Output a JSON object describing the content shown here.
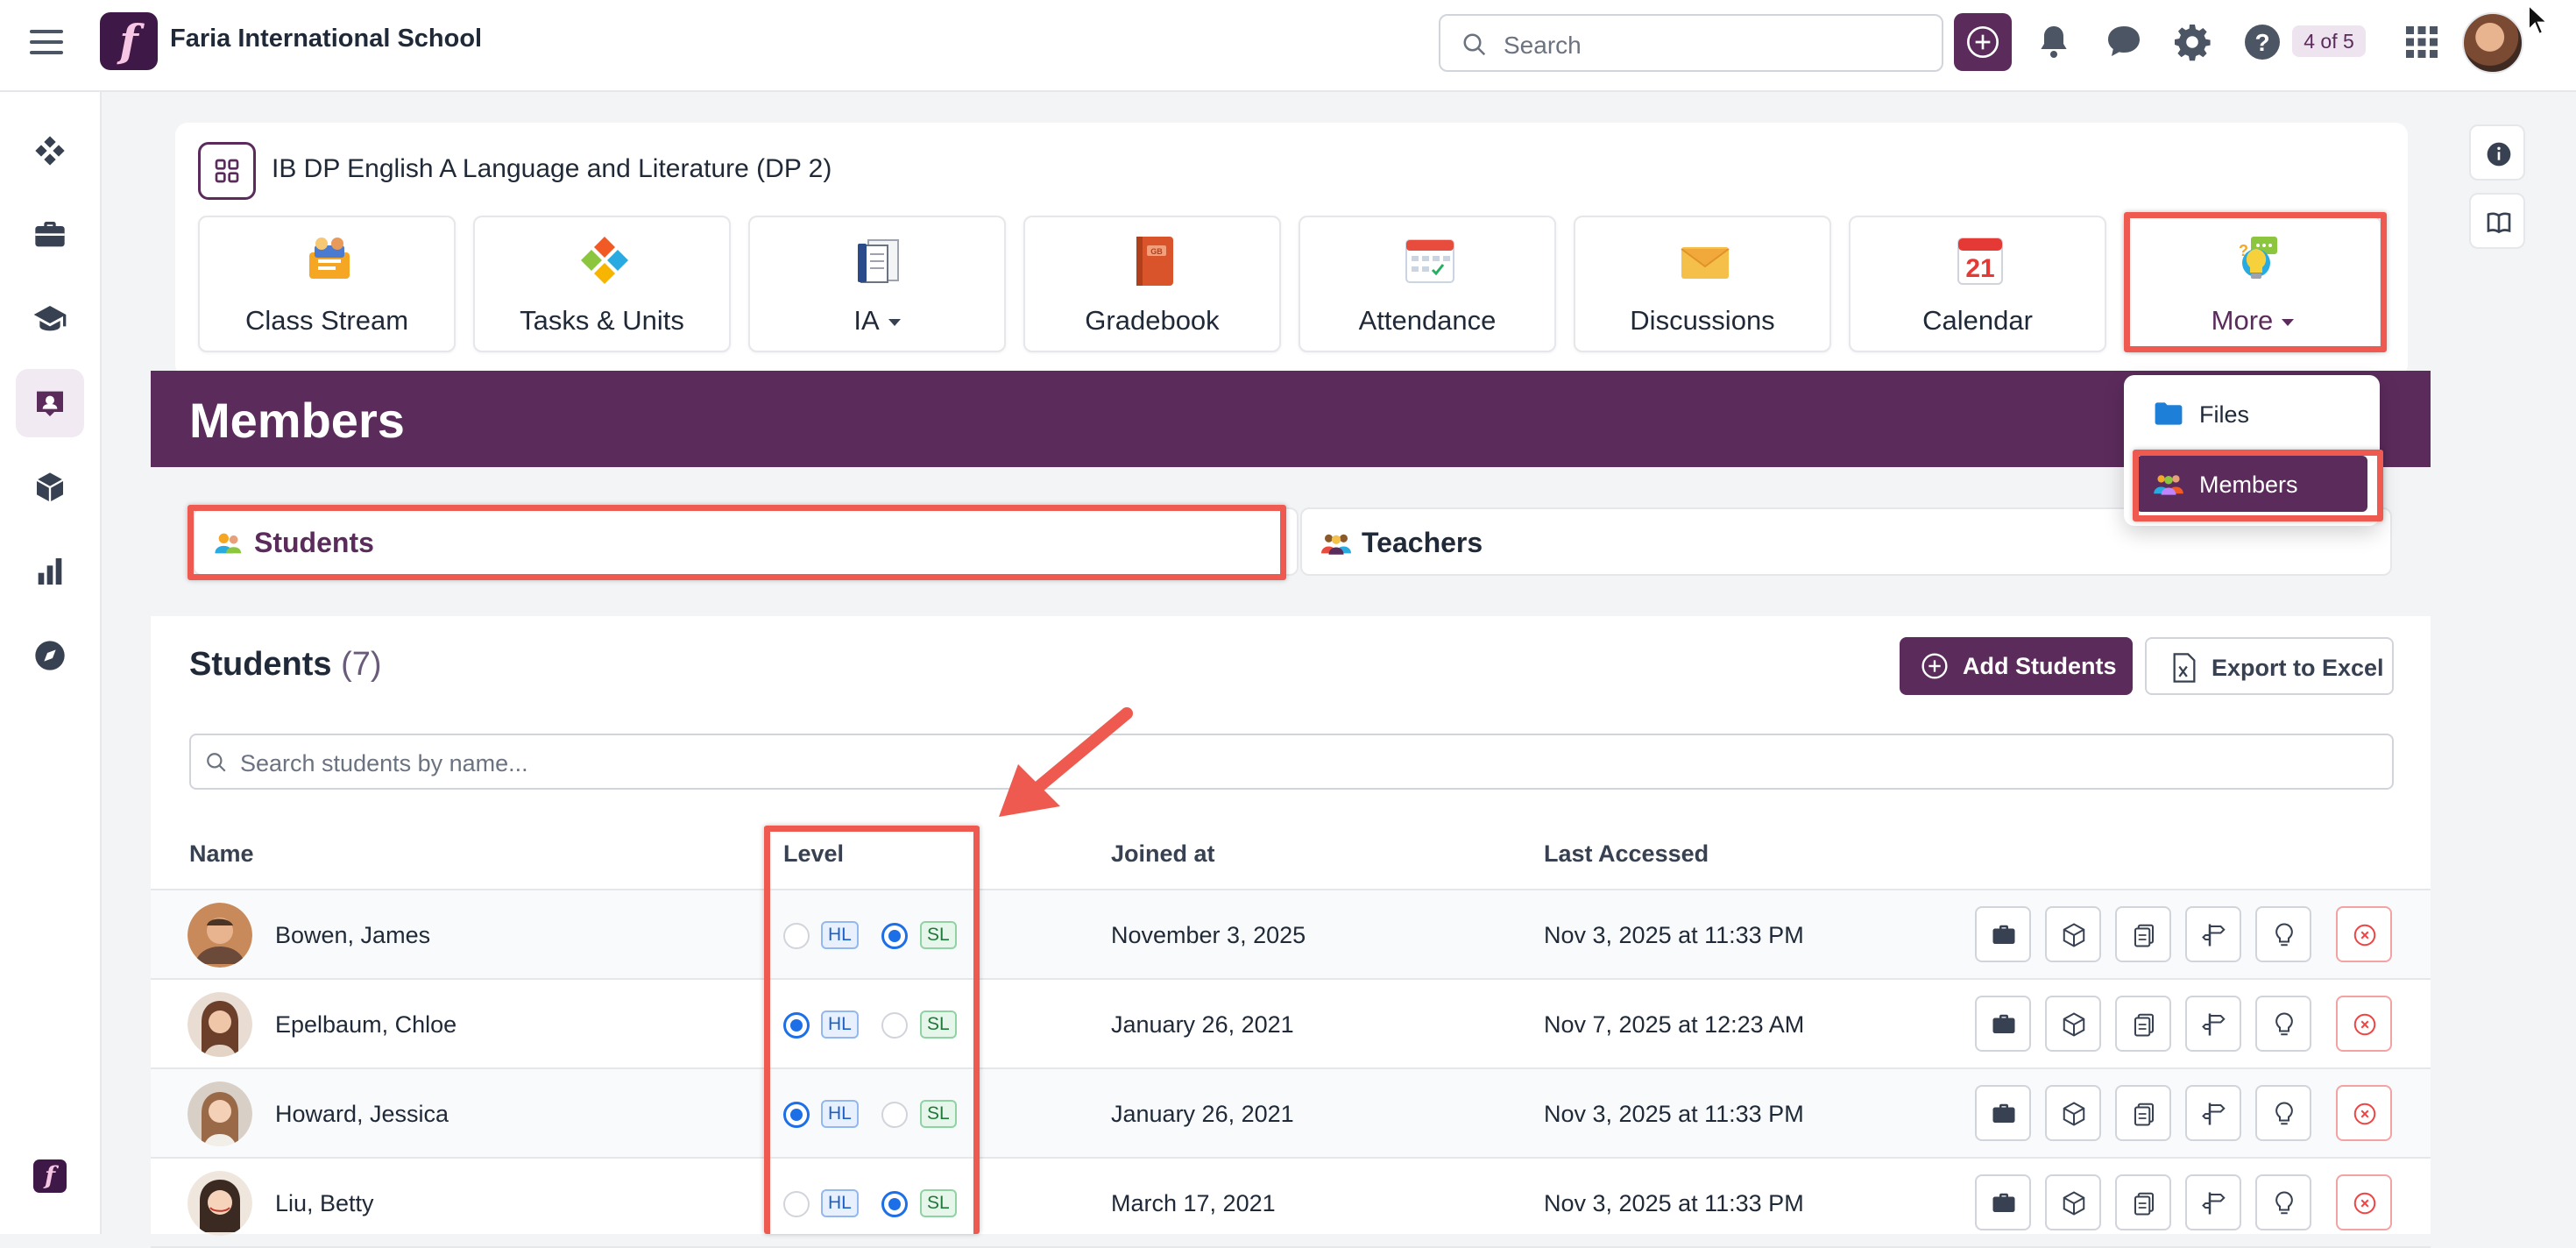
{
  "topbar": {
    "school_name": "Faria International School",
    "logo_letter": "f",
    "search_placeholder": "Search",
    "help_badge": "4 of 5",
    "icons": [
      "menu-icon",
      "plus-icon",
      "bell-icon",
      "chat-icon",
      "gear-icon",
      "help-icon",
      "apps-grid-icon",
      "avatar"
    ]
  },
  "sidebar": {
    "items": [
      "dashboard-icon",
      "briefcase-icon",
      "graduation-cap-icon",
      "class-icon",
      "cube-icon",
      "chart-icon",
      "compass-icon"
    ],
    "active_index": 3
  },
  "course": {
    "title": "IB DP English A Language and Literature (DP 2)",
    "tiles": [
      {
        "label": "Class Stream",
        "icon": "class-stream-icon"
      },
      {
        "label": "Tasks & Units",
        "icon": "puzzle-icon"
      },
      {
        "label": "IA",
        "icon": "documents-icon",
        "dropdown": true
      },
      {
        "label": "Gradebook",
        "icon": "gradebook-icon"
      },
      {
        "label": "Attendance",
        "icon": "attendance-icon"
      },
      {
        "label": "Discussions",
        "icon": "envelope-icon"
      },
      {
        "label": "Calendar",
        "icon": "calendar-icon",
        "calendar_day": "21"
      },
      {
        "label": "More",
        "icon": "more-icon",
        "dropdown": true
      }
    ]
  },
  "banner": {
    "title": "Members"
  },
  "more_menu": {
    "items": [
      {
        "label": "Files",
        "icon": "folder-icon"
      },
      {
        "label": "Members",
        "icon": "members-icon",
        "selected": true
      }
    ]
  },
  "tabs": {
    "students": "Students",
    "teachers": "Teachers"
  },
  "students_panel": {
    "title": "Students",
    "count": "(7)",
    "add_button": "Add Students",
    "export_button": "Export to Excel",
    "search_placeholder": "Search students by name...",
    "columns": {
      "name": "Name",
      "level": "Level",
      "joined": "Joined at",
      "last_accessed": "Last Accessed"
    },
    "level_labels": {
      "hl": "HL",
      "sl": "SL"
    },
    "rows": [
      {
        "name": "Bowen, James",
        "level": "SL",
        "joined": "November 3, 2025",
        "last_accessed": "Nov 3, 2025 at 11:33 PM"
      },
      {
        "name": "Epelbaum, Chloe",
        "level": "HL",
        "joined": "January 26, 2021",
        "last_accessed": "Nov 7, 2025 at 12:23 AM"
      },
      {
        "name": "Howard, Jessica",
        "level": "HL",
        "joined": "January 26, 2021",
        "last_accessed": "Nov 3, 2025 at 11:33 PM"
      },
      {
        "name": "Liu, Betty",
        "level": "SL",
        "joined": "March 17, 2021",
        "last_accessed": "Nov 3, 2025 at 11:33 PM"
      }
    ],
    "row_actions": [
      "briefcase-icon",
      "cube-icon",
      "copy-icon",
      "signpost-icon",
      "lightbulb-icon",
      "remove-icon"
    ]
  },
  "colors": {
    "brand": "#5b2b5c",
    "highlight": "#ee5a4f",
    "radio_selected": "#1d6fe8"
  }
}
